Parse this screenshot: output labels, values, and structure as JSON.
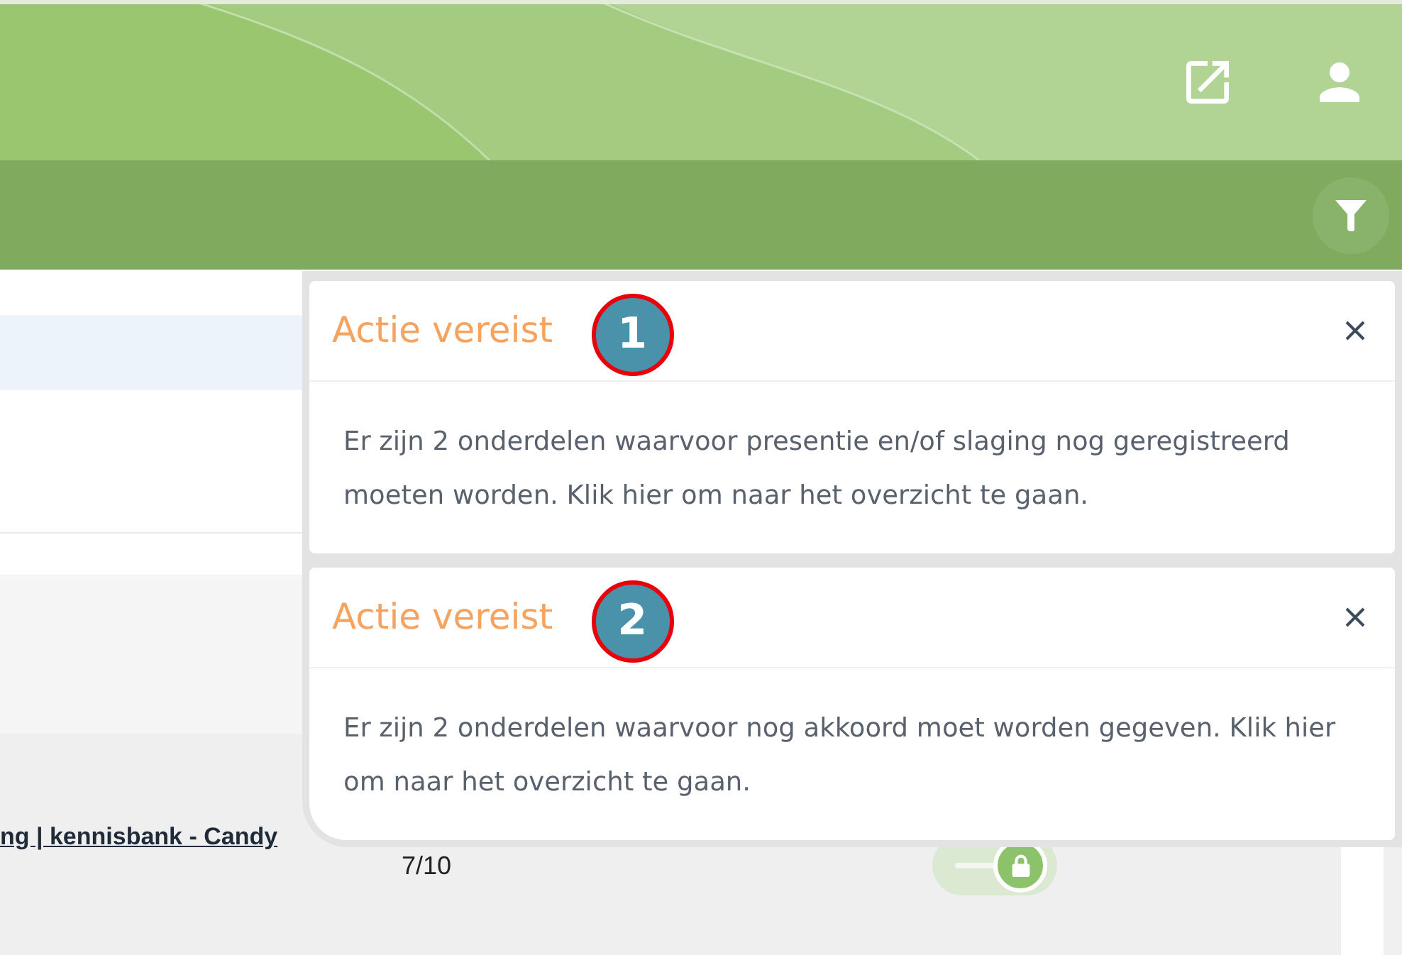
{
  "notifications": [
    {
      "title": "Actie vereist",
      "callout": "1",
      "message": "Er zijn 2 onderdelen waarvoor presentie en/of slaging nog geregistreerd moeten worden. Klik hier om naar het overzicht te gaan."
    },
    {
      "title": "Actie vereist",
      "callout": "2",
      "message": "Er zijn 2 onderdelen waarvoor nog akkoord moet worden gegeven. Klik hier om naar het overzicht te gaan."
    }
  ],
  "list": {
    "rows": [
      {
        "link": "ng | kennisbank - Candy",
        "score": "7/10",
        "toggle": {
          "on": true,
          "locked": true
        }
      }
    ]
  }
}
